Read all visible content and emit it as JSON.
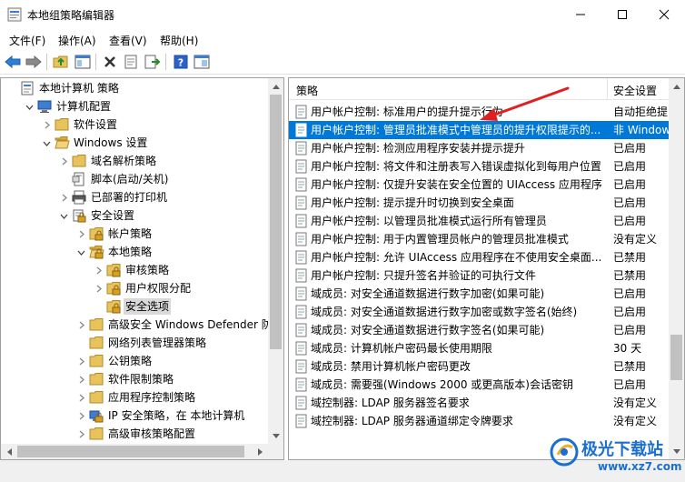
{
  "window": {
    "title": "本地组策略编辑器"
  },
  "menu": [
    "文件(F)",
    "操作(A)",
    "查看(V)",
    "帮助(H)"
  ],
  "toolbar": {
    "buttons": [
      "back-arrow-icon",
      "forward-arrow-icon",
      "folder-up-icon",
      "show-hide-tree-icon",
      "delete-icon",
      "properties-icon",
      "export-list-icon",
      "help-icon",
      "view-icon"
    ]
  },
  "tree": [
    {
      "label": "本地计算机 策略",
      "icon": "policy-icon",
      "expander": "none"
    },
    {
      "label": "计算机配置",
      "icon": "computer-icon",
      "expander": "expanded"
    },
    {
      "label": "软件设置",
      "icon": "folder-icon",
      "expander": "collapsed"
    },
    {
      "label": "Windows 设置",
      "icon": "folder-open-icon",
      "expander": "expanded"
    },
    {
      "label": "域名解析策略",
      "icon": "folder-icon",
      "expander": "collapsed"
    },
    {
      "label": "脚本(启动/关机)",
      "icon": "script-icon",
      "expander": "none"
    },
    {
      "label": "已部署的打印机",
      "icon": "printer-icon",
      "expander": "collapsed"
    },
    {
      "label": "安全设置",
      "icon": "security-icon",
      "expander": "expanded"
    },
    {
      "label": "帐户策略",
      "icon": "folder-lock-icon",
      "expander": "collapsed"
    },
    {
      "label": "本地策略",
      "icon": "folder-lock-open-icon",
      "expander": "expanded"
    },
    {
      "label": "审核策略",
      "icon": "folder-lock-icon",
      "expander": "collapsed"
    },
    {
      "label": "用户权限分配",
      "icon": "folder-lock-icon",
      "expander": "collapsed"
    },
    {
      "label": "安全选项",
      "icon": "folder-lock-icon",
      "expander": "none",
      "selected": true
    },
    {
      "label": "高级安全 Windows Defender 防火",
      "icon": "folder-icon",
      "expander": "collapsed"
    },
    {
      "label": "网络列表管理器策略",
      "icon": "folder-icon",
      "expander": "none"
    },
    {
      "label": "公钥策略",
      "icon": "folder-icon",
      "expander": "collapsed"
    },
    {
      "label": "软件限制策略",
      "icon": "folder-icon",
      "expander": "collapsed"
    },
    {
      "label": "应用程序控制策略",
      "icon": "folder-icon",
      "expander": "collapsed"
    },
    {
      "label": "IP 安全策略，在 本地计算机",
      "icon": "ip-security-icon",
      "expander": "collapsed"
    },
    {
      "label": "高级审核策略配置",
      "icon": "folder-icon",
      "expander": "collapsed"
    }
  ],
  "list": {
    "columns": [
      "策略",
      "安全设置"
    ],
    "rows": [
      {
        "policy": "用户帐户控制: 标准用户的提升提示行为",
        "setting": "自动拒绝提"
      },
      {
        "policy": "用户帐户控制: 管理员批准模式中管理员的提升权限提示的...",
        "setting": "非 Window",
        "selected": true
      },
      {
        "policy": "用户帐户控制: 检测应用程序安装并提示提升",
        "setting": "已启用"
      },
      {
        "policy": "用户帐户控制: 将文件和注册表写入错误虚拟化到每用户位置",
        "setting": "已启用"
      },
      {
        "policy": "用户帐户控制: 仅提升安装在安全位置的 UIAccess 应用程序",
        "setting": "已启用"
      },
      {
        "policy": "用户帐户控制: 提示提升时切换到安全桌面",
        "setting": "已启用"
      },
      {
        "policy": "用户帐户控制: 以管理员批准模式运行所有管理员",
        "setting": "已启用"
      },
      {
        "policy": "用户帐户控制: 用于内置管理员帐户的管理员批准模式",
        "setting": "没有定义"
      },
      {
        "policy": "用户帐户控制: 允许 UIAccess 应用程序在不使用安全桌面...",
        "setting": "已禁用"
      },
      {
        "policy": "用户帐户控制: 只提升签名并验证的可执行文件",
        "setting": "已禁用"
      },
      {
        "policy": "域成员: 对安全通道数据进行数字加密(如果可能)",
        "setting": "已启用"
      },
      {
        "policy": "域成员: 对安全通道数据进行数字加密或数字签名(始终)",
        "setting": "已启用"
      },
      {
        "policy": "域成员: 对安全通道数据进行数字签名(如果可能)",
        "setting": "已启用"
      },
      {
        "policy": "域成员: 计算机帐户密码最长使用期限",
        "setting": "30 天"
      },
      {
        "policy": "域成员: 禁用计算机帐户密码更改",
        "setting": "已禁用"
      },
      {
        "policy": "域成员: 需要强(Windows 2000 或更高版本)会话密钥",
        "setting": "已启用"
      },
      {
        "policy": "域控制器: LDAP 服务器签名要求",
        "setting": "没有定义"
      },
      {
        "policy": "域控制器: LDAP 服务器通道绑定令牌要求",
        "setting": "没有定义"
      }
    ]
  },
  "watermark": {
    "text": "极光下载站",
    "url": "www.xz7.com"
  },
  "colors": {
    "selection": "#0078d7",
    "annotation_arrow": "#e02020",
    "folder": "#e8c25a"
  }
}
